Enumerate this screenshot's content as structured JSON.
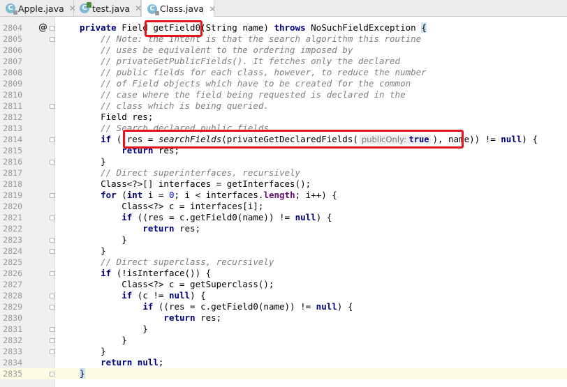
{
  "tabs": [
    {
      "label": "Apple.java",
      "icon": "java-class-icon",
      "active": false
    },
    {
      "label": "test.java",
      "icon": "java-class-icon",
      "active": false
    },
    {
      "label": "Class.java",
      "icon": "java-class-icon",
      "active": true
    }
  ],
  "lines": [
    {
      "n": "2804",
      "segs": [
        [
          "kw",
          "private"
        ],
        [
          "t",
          " Field "
        ],
        [
          "t",
          "getField0"
        ],
        [
          "t",
          "(String name) "
        ],
        [
          "kw",
          "throws"
        ],
        [
          "t",
          " NoSuchFieldException "
        ],
        [
          "b",
          "{"
        ]
      ]
    },
    {
      "n": "2805",
      "segs": [
        [
          "t",
          "    "
        ],
        [
          "cm",
          "// Note: the intent is that the search algorithm this routine"
        ]
      ]
    },
    {
      "n": "2806",
      "segs": [
        [
          "t",
          "    "
        ],
        [
          "cm",
          "// uses be equivalent to the ordering imposed by"
        ]
      ]
    },
    {
      "n": "2807",
      "segs": [
        [
          "t",
          "    "
        ],
        [
          "cm",
          "// privateGetPublicFields(). It fetches only the declared"
        ]
      ]
    },
    {
      "n": "2808",
      "segs": [
        [
          "t",
          "    "
        ],
        [
          "cm",
          "// public fields for each class, however, to reduce the number"
        ]
      ]
    },
    {
      "n": "2809",
      "segs": [
        [
          "t",
          "    "
        ],
        [
          "cm",
          "// of Field objects which have to be created for the common"
        ]
      ]
    },
    {
      "n": "2810",
      "segs": [
        [
          "t",
          "    "
        ],
        [
          "cm",
          "// case where the field being requested is declared in the"
        ]
      ]
    },
    {
      "n": "2811",
      "segs": [
        [
          "t",
          "    "
        ],
        [
          "cm",
          "// class which is being queried."
        ]
      ]
    },
    {
      "n": "2812",
      "segs": [
        [
          "t",
          "    Field res;"
        ]
      ]
    },
    {
      "n": "2813",
      "segs": [
        [
          "t",
          "    "
        ],
        [
          "cm",
          "// Search declared public fields"
        ]
      ]
    },
    {
      "n": "2814",
      "segs": [
        [
          "t",
          "    "
        ],
        [
          "kw",
          "if"
        ],
        [
          "t",
          " ((res = "
        ],
        [
          "it",
          "searchFields"
        ],
        [
          "t",
          "(privateGetDeclaredFields("
        ],
        [
          "hint",
          "publicOnly:",
          "true"
        ],
        [
          "t",
          "), name)) != "
        ],
        [
          "kw",
          "null"
        ],
        [
          "t",
          ") {"
        ]
      ]
    },
    {
      "n": "2815",
      "segs": [
        [
          "t",
          "        "
        ],
        [
          "kw",
          "return"
        ],
        [
          "t",
          " res;"
        ]
      ]
    },
    {
      "n": "2816",
      "segs": [
        [
          "t",
          "    }"
        ]
      ]
    },
    {
      "n": "2817",
      "segs": [
        [
          "t",
          "    "
        ],
        [
          "cm",
          "// Direct superinterfaces, recursively"
        ]
      ]
    },
    {
      "n": "2818",
      "segs": [
        [
          "t",
          "    Class<?>[] interfaces = getInterfaces();"
        ]
      ]
    },
    {
      "n": "2819",
      "segs": [
        [
          "t",
          "    "
        ],
        [
          "kw",
          "for"
        ],
        [
          "t",
          " ("
        ],
        [
          "kw",
          "int"
        ],
        [
          "t",
          " i = "
        ],
        [
          "num",
          "0"
        ],
        [
          "t",
          "; i < interfaces."
        ],
        [
          "fld",
          "length"
        ],
        [
          "t",
          "; i++) {"
        ]
      ]
    },
    {
      "n": "2820",
      "segs": [
        [
          "t",
          "        Class<?> c = interfaces[i];"
        ]
      ]
    },
    {
      "n": "2821",
      "segs": [
        [
          "t",
          "        "
        ],
        [
          "kw",
          "if"
        ],
        [
          "t",
          " ((res = c.getField0(name)) != "
        ],
        [
          "kw",
          "null"
        ],
        [
          "t",
          ") {"
        ]
      ]
    },
    {
      "n": "2822",
      "segs": [
        [
          "t",
          "            "
        ],
        [
          "kw",
          "return"
        ],
        [
          "t",
          " res;"
        ]
      ]
    },
    {
      "n": "2823",
      "segs": [
        [
          "t",
          "        }"
        ]
      ]
    },
    {
      "n": "2824",
      "segs": [
        [
          "t",
          "    }"
        ]
      ]
    },
    {
      "n": "2825",
      "segs": [
        [
          "t",
          "    "
        ],
        [
          "cm",
          "// Direct superclass, recursively"
        ]
      ]
    },
    {
      "n": "2826",
      "segs": [
        [
          "t",
          "    "
        ],
        [
          "kw",
          "if"
        ],
        [
          "t",
          " (!isInterface()) {"
        ]
      ]
    },
    {
      "n": "2827",
      "segs": [
        [
          "t",
          "        Class<?> c = getSuperclass();"
        ]
      ]
    },
    {
      "n": "2828",
      "segs": [
        [
          "t",
          "        "
        ],
        [
          "kw",
          "if"
        ],
        [
          "t",
          " (c != "
        ],
        [
          "kw",
          "null"
        ],
        [
          "t",
          ") {"
        ]
      ]
    },
    {
      "n": "2829",
      "segs": [
        [
          "t",
          "            "
        ],
        [
          "kw",
          "if"
        ],
        [
          "t",
          " ((res = c.getField0(name)) != "
        ],
        [
          "kw",
          "null"
        ],
        [
          "t",
          ") {"
        ]
      ]
    },
    {
      "n": "2830",
      "segs": [
        [
          "t",
          "                "
        ],
        [
          "kw",
          "return"
        ],
        [
          "t",
          " res;"
        ]
      ]
    },
    {
      "n": "2831",
      "segs": [
        [
          "t",
          "            }"
        ]
      ]
    },
    {
      "n": "2832",
      "segs": [
        [
          "t",
          "        }"
        ]
      ]
    },
    {
      "n": "2833",
      "segs": [
        [
          "t",
          "    }"
        ]
      ]
    },
    {
      "n": "2834",
      "segs": [
        [
          "t",
          "    "
        ],
        [
          "kw",
          "return"
        ],
        [
          "t",
          " "
        ],
        [
          "kw",
          "null"
        ],
        [
          "t",
          ";"
        ]
      ]
    },
    {
      "n": "2835",
      "segs": [
        [
          "b",
          "}"
        ]
      ]
    }
  ],
  "current_line": "2835",
  "gutter_marker": {
    "line": "2804",
    "symbol": "@"
  },
  "colors": {
    "highlight_box": "#e3141d",
    "keyword": "#000080",
    "comment": "#808080"
  }
}
